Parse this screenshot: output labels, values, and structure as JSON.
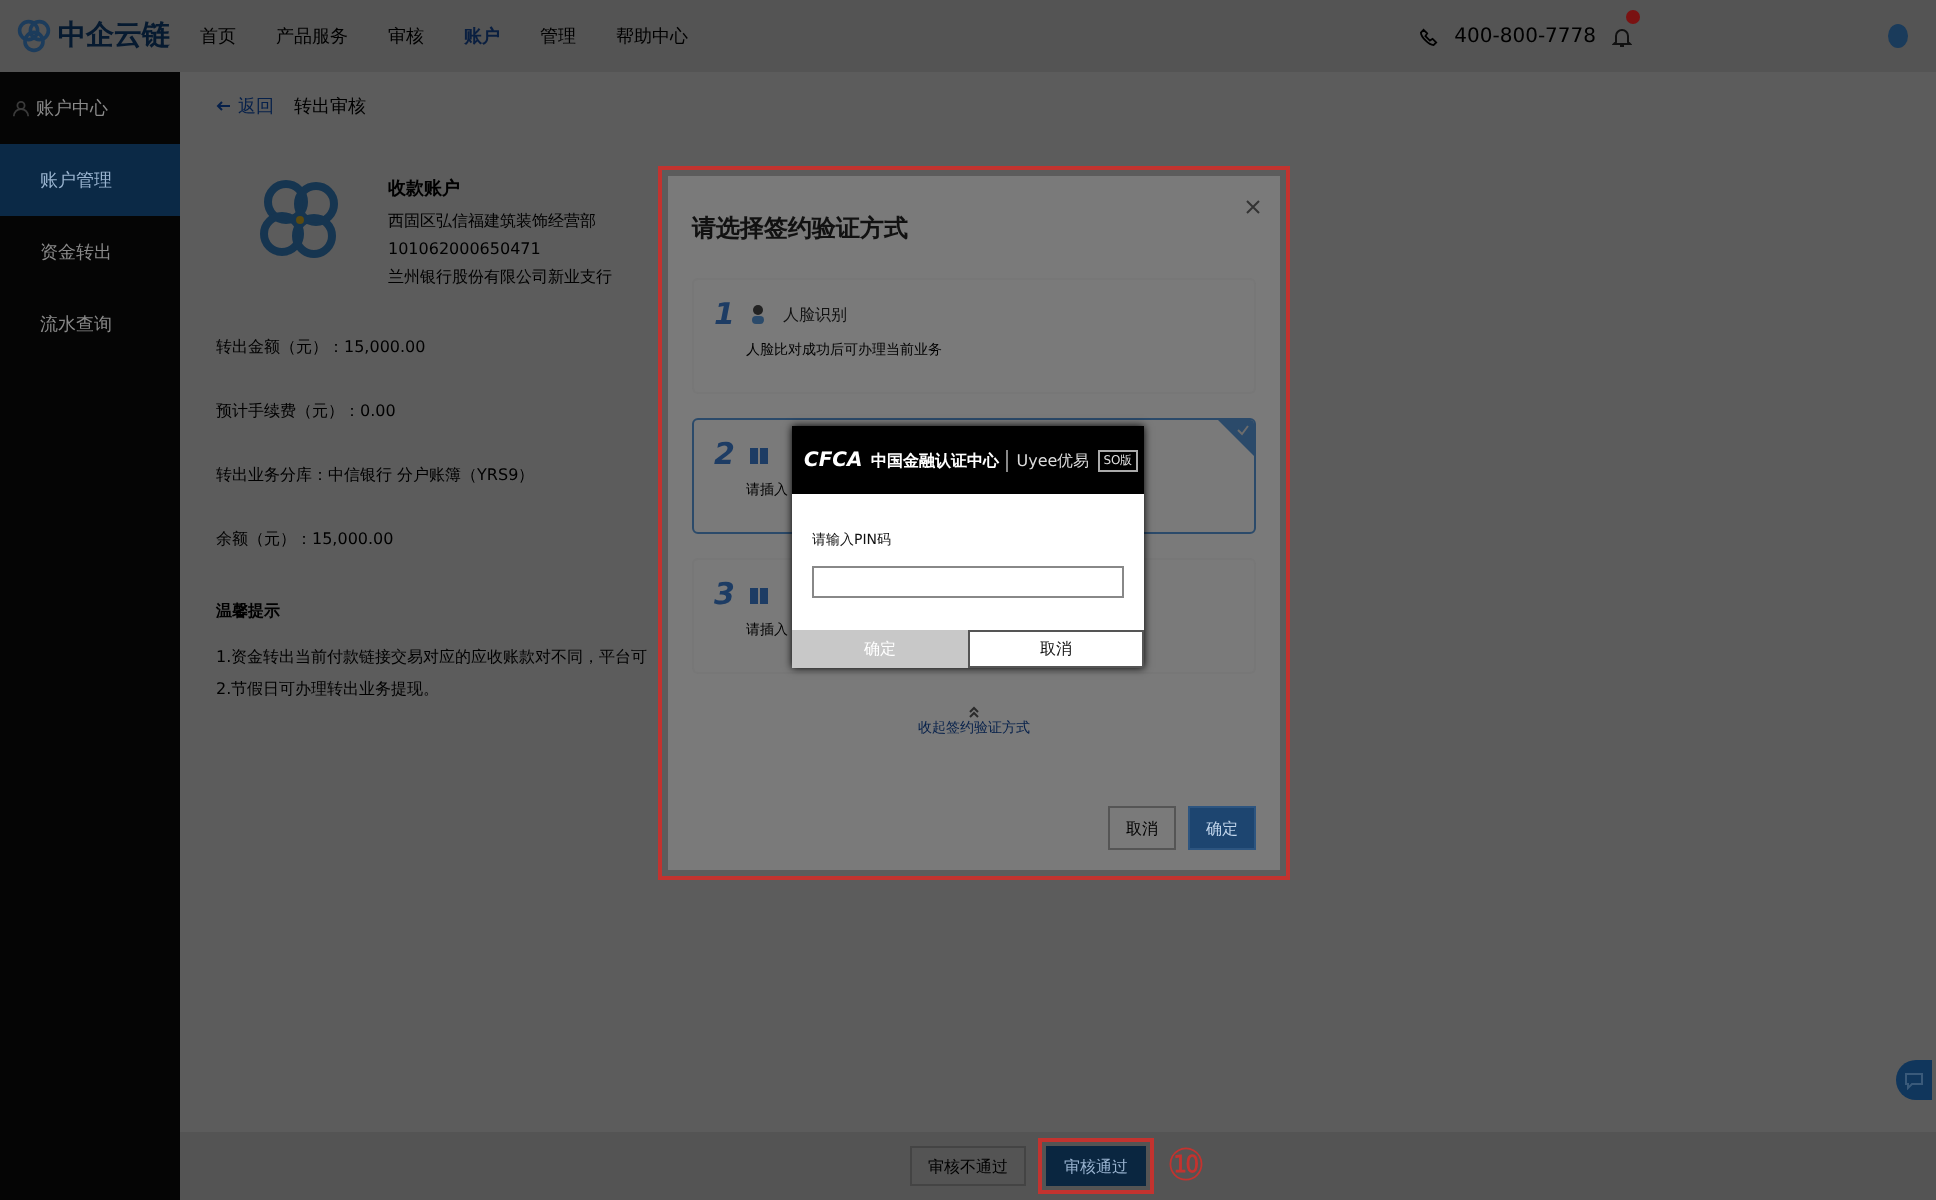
{
  "nav": {
    "logo": "中企云链",
    "items": [
      {
        "label": "首页",
        "selected": false
      },
      {
        "label": "产品服务",
        "selected": false
      },
      {
        "label": "审核",
        "selected": false
      },
      {
        "label": "账户",
        "selected": true
      },
      {
        "label": "管理",
        "selected": false
      },
      {
        "label": "帮助中心",
        "selected": false
      }
    ],
    "phone": "400-800-7778",
    "notification": true
  },
  "sidebar": {
    "title": "账户中心",
    "items": [
      {
        "label": "账户管理",
        "selected": true
      },
      {
        "label": "资金转出",
        "selected": false
      },
      {
        "label": "流水查询",
        "selected": false
      }
    ]
  },
  "breadcrumb": {
    "back": "返回",
    "title": "转出审核"
  },
  "account": {
    "heading": "收款账户",
    "lines": [
      "西固区弘信福建筑装饰经营部",
      "101062000650471",
      "兰州银行股份有限公司新业支行"
    ]
  },
  "fields": [
    "转出金额（元）：15,000.00",
    "预计手续费（元）：0.00",
    "转出业务分库：中信银行 分户账簿（YRS9）",
    "余额（元）：15,000.00"
  ],
  "notice": {
    "title": "温馨提示",
    "lines": [
      "1.资金转出当前付款链接交易对应的应收账款对不同，平台可",
      "2.节假日可办理转出业务提现。"
    ]
  },
  "modal": {
    "title": "请选择签约验证方式",
    "options": [
      {
        "number": "1",
        "name": "人脸识别",
        "desc": "人脸比对成功后可办理当前业务",
        "selected": false
      },
      {
        "number": "2",
        "desc": "请插入",
        "selected": true
      },
      {
        "number": "3",
        "desc": "请插入",
        "selected": false
      }
    ],
    "collapse": "收起签约验证方式",
    "cancel": "取消",
    "confirm": "确定"
  },
  "pin_dialog": {
    "brand": "CFCA",
    "org": "中国金融认证中心",
    "product": "Uyee优易",
    "edition": "SO版",
    "label": "请输入PIN码",
    "confirm": "确定",
    "confirm_disabled": true,
    "cancel": "取消"
  },
  "footer": {
    "reject": "审核不通过",
    "approve": "审核通过",
    "step": "⑩"
  }
}
